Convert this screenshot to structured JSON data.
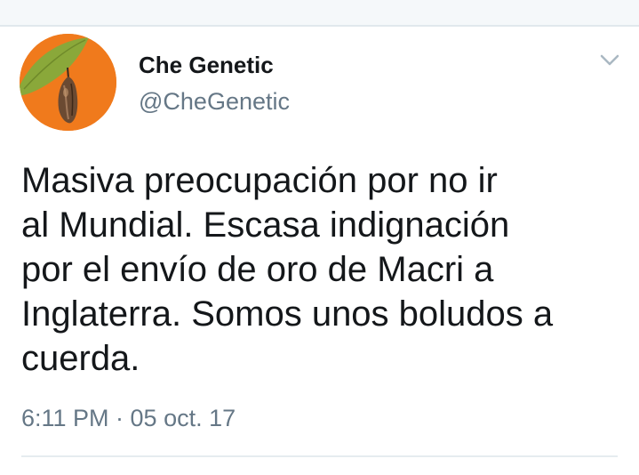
{
  "tweet": {
    "author": {
      "display_name": "Che Genetic",
      "handle": "@CheGenetic",
      "avatar_icon": "chrysalis-avatar",
      "avatar_bg": "#f07a1c"
    },
    "text_lines": [
      "Masiva preocupación por no ir",
      "al Mundial. Escasa indignación",
      "por el envío de oro de Macri a",
      "Inglaterra. Somos unos boludos a",
      "cuerda."
    ],
    "timestamp": "6:11 PM · 05 oct. 17",
    "menu_icon": "chevron-down-icon"
  },
  "colors": {
    "text_primary": "#14171a",
    "text_secondary": "#657786",
    "divider": "#e6ecf0",
    "top_band": "#f5f8fa"
  }
}
